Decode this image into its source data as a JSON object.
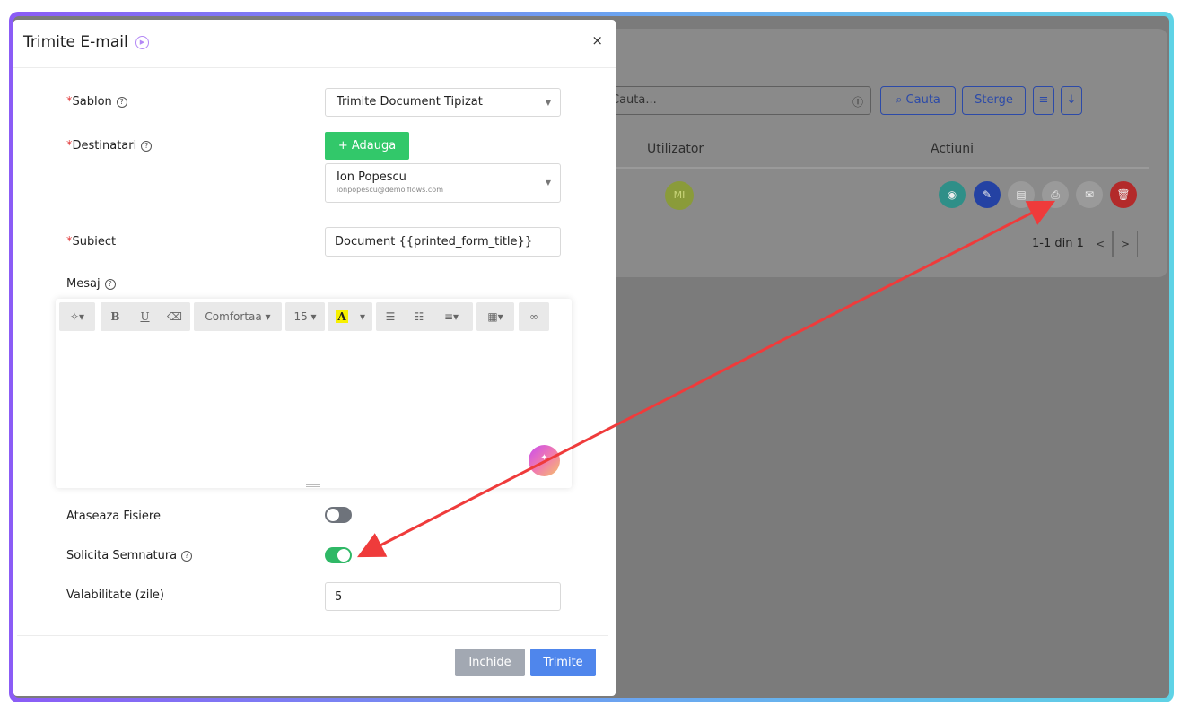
{
  "modal": {
    "title": "Trimite E-mail",
    "close": "×",
    "template": {
      "label": "Sablon",
      "value": "Trimite Document Tipizat"
    },
    "recipients": {
      "label": "Destinatari",
      "add_button": "+ Adauga",
      "name": "Ion Popescu",
      "email": "ionpopescu@demoiflows.com"
    },
    "subject": {
      "label": "Subiect",
      "value": "Document {{printed_form_title}}"
    },
    "message": {
      "label": "Mesaj",
      "toolbar": {
        "magic": "magic-wand-icon",
        "bold": "B",
        "underline": "U",
        "eraser": "eraser-icon",
        "font": "Comfortaa",
        "size": "15",
        "color": "A",
        "ul": "bullet-list-icon",
        "ol": "numbered-list-icon",
        "align": "align-icon",
        "table": "table-icon",
        "link": "link-icon"
      }
    },
    "attach": {
      "label": "Ataseaza Fisiere",
      "checked": false
    },
    "signature": {
      "label": "Solicita Semnatura",
      "checked": true
    },
    "validity": {
      "label": "Valabilitate (zile)",
      "value": "5"
    },
    "buttons": {
      "close": "Inchide",
      "send": "Trimite"
    }
  },
  "background": {
    "search_placeholder": "Cauta...",
    "search_button": "Cauta",
    "clear_button": "Sterge",
    "columns": [
      "Utilizator",
      "Actiuni"
    ],
    "avatar": "MI",
    "pagination": "1-1 din 1",
    "prev": "<",
    "next": ">"
  },
  "colors": {
    "accent": "#4f86ec",
    "success": "#32c86a",
    "annotation_arrow": "#ef3b3b"
  }
}
